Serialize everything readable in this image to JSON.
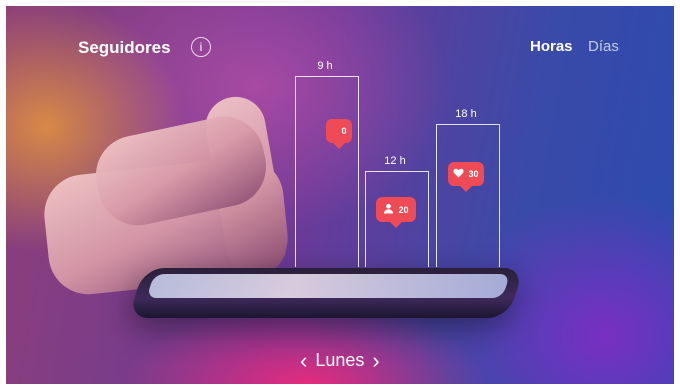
{
  "header": {
    "title": "Seguidores",
    "info_symbol": "i",
    "tabs": [
      {
        "label": "Horas",
        "active": true
      },
      {
        "label": "Días",
        "active": false
      }
    ]
  },
  "chart_data": {
    "type": "bar",
    "categories": [
      "9 h",
      "12 h",
      "18 h"
    ],
    "values": [
      0,
      20,
      30
    ],
    "badge_icons": [
      "",
      "user-icon",
      "heart-icon"
    ],
    "badge_values": [
      "0",
      "20",
      "30"
    ]
  },
  "footer": {
    "day": "Lunes",
    "prev_symbol": "‹",
    "next_symbol": "›"
  },
  "colors": {
    "accent": "#ee4b56",
    "text": "#ffffff"
  }
}
